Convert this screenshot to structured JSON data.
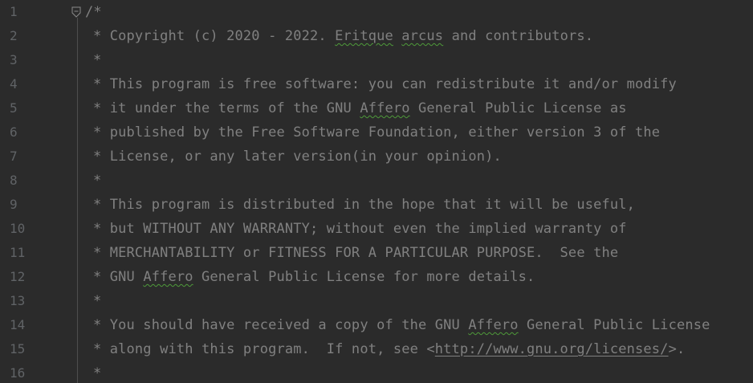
{
  "editor": {
    "lines": [
      {
        "n": "1",
        "segs": [
          {
            "t": "/*"
          }
        ]
      },
      {
        "n": "2",
        "segs": [
          {
            "t": "* Copyright (c) 2020 - 2022. "
          },
          {
            "t": "Eritque",
            "sq": true
          },
          {
            "t": " "
          },
          {
            "t": "arcus",
            "sq": true
          },
          {
            "t": " and contributors."
          }
        ]
      },
      {
        "n": "3",
        "segs": [
          {
            "t": "*"
          }
        ]
      },
      {
        "n": "4",
        "segs": [
          {
            "t": "* This program is free software: you can redistribute it and/or modify"
          }
        ]
      },
      {
        "n": "5",
        "segs": [
          {
            "t": "* it under the terms of the GNU "
          },
          {
            "t": "Affero",
            "sq": true
          },
          {
            "t": " General Public License as"
          }
        ]
      },
      {
        "n": "6",
        "segs": [
          {
            "t": "* published by the Free Software Foundation, either version 3 of the"
          }
        ]
      },
      {
        "n": "7",
        "segs": [
          {
            "t": "* License, or any later version(in your opinion)."
          }
        ]
      },
      {
        "n": "8",
        "segs": [
          {
            "t": "*"
          }
        ]
      },
      {
        "n": "9",
        "segs": [
          {
            "t": "* This program is distributed in the hope that it will be useful,"
          }
        ]
      },
      {
        "n": "10",
        "segs": [
          {
            "t": "* but WITHOUT ANY WARRANTY; without even the implied warranty of"
          }
        ]
      },
      {
        "n": "11",
        "segs": [
          {
            "t": "* MERCHANTABILITY or FITNESS FOR A PARTICULAR PURPOSE.  See the"
          }
        ]
      },
      {
        "n": "12",
        "segs": [
          {
            "t": "* GNU "
          },
          {
            "t": "Affero",
            "sq": true
          },
          {
            "t": " General Public License for more details."
          }
        ]
      },
      {
        "n": "13",
        "segs": [
          {
            "t": "*"
          }
        ]
      },
      {
        "n": "14",
        "segs": [
          {
            "t": "* You should have received a copy of the GNU "
          },
          {
            "t": "Affero",
            "sq": true
          },
          {
            "t": " General Public License"
          }
        ]
      },
      {
        "n": "15",
        "segs": [
          {
            "t": "* along with this program.  If not, see <"
          },
          {
            "t": "http://www.gnu.org/licenses/",
            "url": true
          },
          {
            "t": ">."
          }
        ]
      },
      {
        "n": "16",
        "segs": [
          {
            "t": "*"
          }
        ]
      }
    ],
    "colors": {
      "background": "#2b2b2b",
      "comment": "#808080",
      "line_number": "#606366",
      "typo_underline": "#4e9a3a"
    },
    "icons": {
      "fold": "fold-collapse-icon"
    }
  }
}
